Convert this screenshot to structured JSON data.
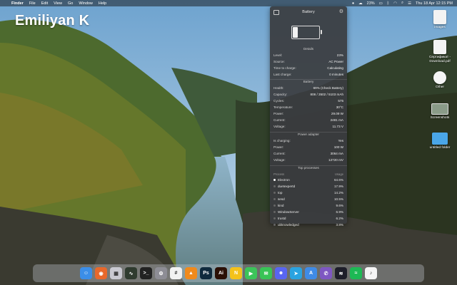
{
  "watermark": "Emiliyan K",
  "menubar": {
    "apple_glyph": "",
    "app_name": "Finder",
    "menus": [
      "File",
      "Edit",
      "View",
      "Go",
      "Window",
      "Help"
    ],
    "datetime": "Thu 18 Apr 12:15 PM",
    "battery_percent_label": "23%"
  },
  "desktop_icons": [
    {
      "label": "images",
      "kind": "doc"
    },
    {
      "label": "Сертификат -\nDownload.pdf",
      "kind": "doc"
    },
    {
      "label": "Other",
      "kind": "round"
    },
    {
      "label": "Screenshots",
      "kind": "shot"
    },
    {
      "label": "untitled folder",
      "kind": "folder"
    }
  ],
  "panel": {
    "title": "Battery",
    "battery_level": 0.23,
    "details_title": "Details",
    "details": [
      {
        "k": "Level:",
        "v": "23%"
      },
      {
        "k": "Source:",
        "v": "AC Power"
      },
      {
        "k": "Time to charge:",
        "v": "Calculating"
      },
      {
        "k": "Last charge:",
        "v": "0 minutes"
      }
    ],
    "battery_title": "Battery",
    "battery": [
      {
        "k": "Health:",
        "v": "69% (Check Battery)"
      },
      {
        "k": "Capacity:",
        "v": "806 / 3502 / 5103 mAh"
      },
      {
        "k": "Cycles:",
        "v": "575"
      },
      {
        "k": "Temperature:",
        "v": "30°C"
      },
      {
        "k": "Power:",
        "v": "29.09 W"
      },
      {
        "k": "Current:",
        "v": "2481 mA"
      },
      {
        "k": "Voltage:",
        "v": "11.73 V"
      }
    ],
    "adapter_title": "Power adapter",
    "adapter": [
      {
        "k": "Is charging:",
        "v": "Yes"
      },
      {
        "k": "Power:",
        "v": "100 W"
      },
      {
        "k": "Current:",
        "v": "3064 mA"
      },
      {
        "k": "Voltage:",
        "v": "12720 mV"
      }
    ],
    "processes_title": "Top processes",
    "process_header": {
      "name": "Process",
      "value": "Usage"
    },
    "processes": [
      {
        "name": "Electron",
        "v": "64.6%",
        "active": true
      },
      {
        "name": "duetexpertd",
        "v": "17.9%",
        "active": false
      },
      {
        "name": "top",
        "v": "14.2%",
        "active": false
      },
      {
        "name": "sesd",
        "v": "10.5%",
        "active": false
      },
      {
        "name": "kind",
        "v": "9.6%",
        "active": false
      },
      {
        "name": "WindowServer",
        "v": "6.9%",
        "active": false
      },
      {
        "name": "trustd",
        "v": "6.2%",
        "active": false
      },
      {
        "name": "ubknowledged",
        "v": "3.8%",
        "active": false
      }
    ]
  },
  "dock": {
    "apps": [
      {
        "name": "finder-icon",
        "color": "#3b8ee8",
        "glyph": "☺"
      },
      {
        "name": "firefox-icon",
        "color": "#e8682b",
        "glyph": "◉"
      },
      {
        "name": "launchpad-icon",
        "color": "#c9c9d1",
        "glyph": "▦"
      },
      {
        "name": "activity-monitor-icon",
        "color": "#2f3b2f",
        "glyph": "∿"
      },
      {
        "name": "terminal-icon",
        "color": "#222222",
        "glyph": ">_"
      },
      {
        "name": "system-settings-icon",
        "color": "#8d8d95",
        "glyph": "⚙"
      },
      {
        "name": "slack-icon",
        "color": "#f2f2f2",
        "glyph": "#"
      },
      {
        "name": "vlc-icon",
        "color": "#f08a1c",
        "glyph": "▲"
      },
      {
        "name": "photoshop-icon",
        "color": "#0f2a3d",
        "glyph": "Ps"
      },
      {
        "name": "illustrator-icon",
        "color": "#2b1006",
        "glyph": "Ai"
      },
      {
        "name": "norton-icon",
        "color": "#f4c21b",
        "glyph": "N"
      },
      {
        "name": "facetime-icon",
        "color": "#3cc45a",
        "glyph": "▶"
      },
      {
        "name": "messages-icon",
        "color": "#38c456",
        "glyph": "✉"
      },
      {
        "name": "discord-icon",
        "color": "#5865f2",
        "glyph": "☻"
      },
      {
        "name": "telegram-icon",
        "color": "#2aa3e0",
        "glyph": "➤"
      },
      {
        "name": "app-store-icon",
        "color": "#3f8be6",
        "glyph": "A"
      },
      {
        "name": "viber-icon",
        "color": "#7e57c2",
        "glyph": "✆"
      },
      {
        "name": "soundboard-icon",
        "color": "#1e1e2a",
        "glyph": "≋"
      },
      {
        "name": "spotify-icon",
        "color": "#1db954",
        "glyph": "≈"
      },
      {
        "name": "music-icon",
        "color": "#f5f5f5",
        "glyph": "♪"
      }
    ]
  }
}
